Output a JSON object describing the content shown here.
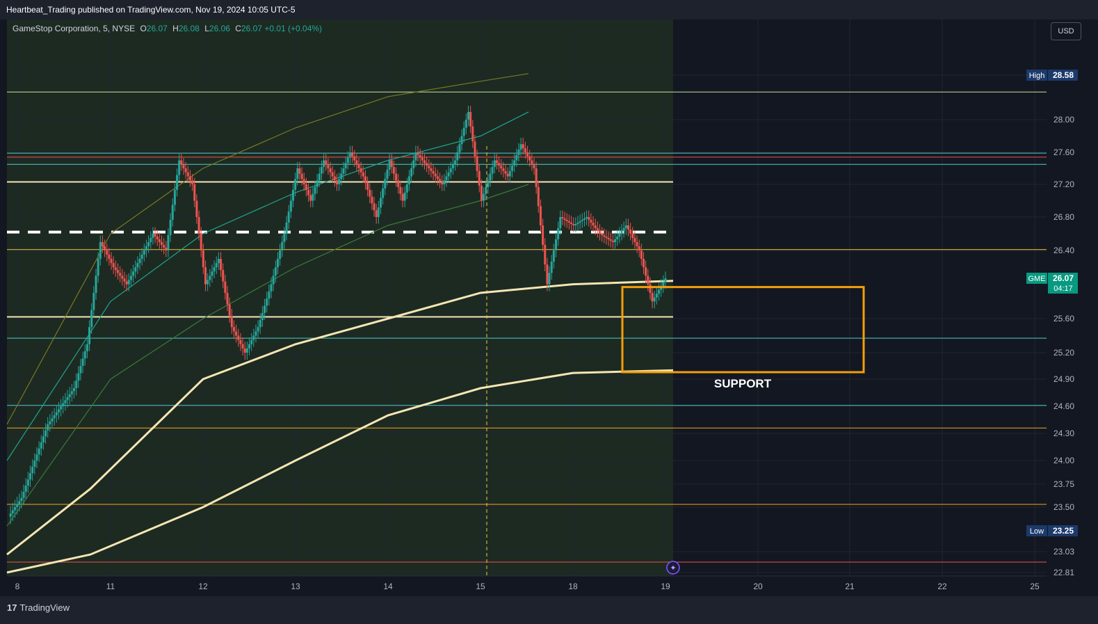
{
  "header": {
    "publisher": "Heartbeat_Trading published on TradingView.com, Nov 19, 2024 10:05 UTC-5"
  },
  "legend": {
    "symbol": "GameStop Corporation, 5, NYSE",
    "o_label": "O",
    "o": "26.07",
    "h_label": "H",
    "h": "26.08",
    "l_label": "L",
    "l": "26.06",
    "c_label": "C",
    "c": "26.07",
    "change": "+0.01 (+0.04%)"
  },
  "currency": "USD",
  "footer": {
    "brand": "TradingView"
  },
  "colors": {
    "background": "#131722",
    "up": "#26a69a",
    "down": "#ef5350",
    "vwap": "#f5e6b3",
    "highlight": "#f59e0b",
    "session": "#1d2a22"
  },
  "chart_data": {
    "type": "candlestick",
    "symbol": "GME",
    "interval": "5",
    "ylim": [
      22.81,
      28.6
    ],
    "x_ticks": [
      "8",
      "11",
      "12",
      "13",
      "14",
      "15",
      "18",
      "19",
      "20",
      "21",
      "22",
      "25"
    ],
    "y_ticks": [
      "27.60",
      "28.00",
      "27.60",
      "27.20",
      "26.80",
      "26.40",
      "25.60",
      "25.20",
      "24.90",
      "24.60",
      "24.30",
      "24.00",
      "23.75",
      "23.50",
      "23.03",
      "22.81"
    ],
    "y_tick_values": [
      28.58,
      28.0,
      27.6,
      27.2,
      26.8,
      26.4,
      25.6,
      25.2,
      24.9,
      24.6,
      24.3,
      24.0,
      23.75,
      23.5,
      23.03,
      22.81
    ],
    "badges": {
      "high_label": "High",
      "high": "28.58",
      "last_label": "GME",
      "last": "26.07",
      "countdown": "04:17",
      "low_label": "Low",
      "low": "23.25"
    },
    "annotation": "SUPPORT",
    "support_zone": {
      "from": 25.0,
      "to": 26.0,
      "x_from": "18",
      "x_to": "21"
    },
    "horizontal_levels": [
      28.36,
      27.59,
      27.54,
      27.45,
      27.23,
      26.62,
      26.41,
      25.62,
      25.37,
      24.61,
      24.36,
      23.53,
      22.92
    ],
    "close_path": [
      [
        "8",
        23.4
      ],
      [
        "8",
        23.6
      ],
      [
        "8",
        24.0
      ],
      [
        "8",
        24.4
      ],
      [
        "8",
        24.6
      ],
      [
        "8",
        24.8
      ],
      [
        "11",
        25.3
      ],
      [
        "11",
        26.5
      ],
      [
        "11",
        26.2
      ],
      [
        "11",
        26.0
      ],
      [
        "11",
        26.3
      ],
      [
        "11",
        26.6
      ],
      [
        "11",
        26.4
      ],
      [
        "12",
        27.5
      ],
      [
        "12",
        27.2
      ],
      [
        "12",
        26.0
      ],
      [
        "12",
        26.3
      ],
      [
        "12",
        25.5
      ],
      [
        "12",
        25.2
      ],
      [
        "12",
        25.5
      ],
      [
        "13",
        26.0
      ],
      [
        "13",
        26.6
      ],
      [
        "13",
        27.4
      ],
      [
        "13",
        27.0
      ],
      [
        "13",
        27.5
      ],
      [
        "13",
        27.2
      ],
      [
        "13",
        27.6
      ],
      [
        "14",
        27.3
      ],
      [
        "14",
        26.8
      ],
      [
        "14",
        27.5
      ],
      [
        "14",
        27.0
      ],
      [
        "14",
        27.6
      ],
      [
        "14",
        27.4
      ],
      [
        "14",
        27.2
      ],
      [
        "15",
        27.5
      ],
      [
        "15",
        28.1
      ],
      [
        "15",
        27.0
      ],
      [
        "15",
        27.5
      ],
      [
        "15",
        27.3
      ],
      [
        "15",
        27.7
      ],
      [
        "15",
        27.4
      ],
      [
        "18",
        26.0
      ],
      [
        "18",
        26.8
      ],
      [
        "18",
        26.7
      ],
      [
        "18",
        26.8
      ],
      [
        "18",
        26.6
      ],
      [
        "18",
        26.5
      ],
      [
        "18",
        26.7
      ],
      [
        "19",
        26.4
      ],
      [
        "19",
        25.8
      ],
      [
        "19",
        26.07
      ]
    ],
    "vwap_bands": [
      {
        "name": "",
        "values": [
          23.0,
          23.7,
          24.9,
          25.3,
          25.6,
          25.9,
          26.0,
          26.04
        ]
      },
      {
        "name": "",
        "values": [
          22.3,
          23.0,
          23.5,
          24.0,
          24.5,
          24.8,
          24.97,
          25.0
        ]
      }
    ],
    "envelope_upper": [
      24.4,
      26.6,
      27.4,
      27.9,
      28.3,
      28.5,
      28.6
    ],
    "envelope_lower": [
      23.3,
      24.9,
      25.6,
      26.2,
      26.7,
      27.0,
      27.2
    ],
    "envelope_mid": [
      24.0,
      25.8,
      26.6,
      27.1,
      27.5,
      27.8,
      28.1
    ]
  }
}
